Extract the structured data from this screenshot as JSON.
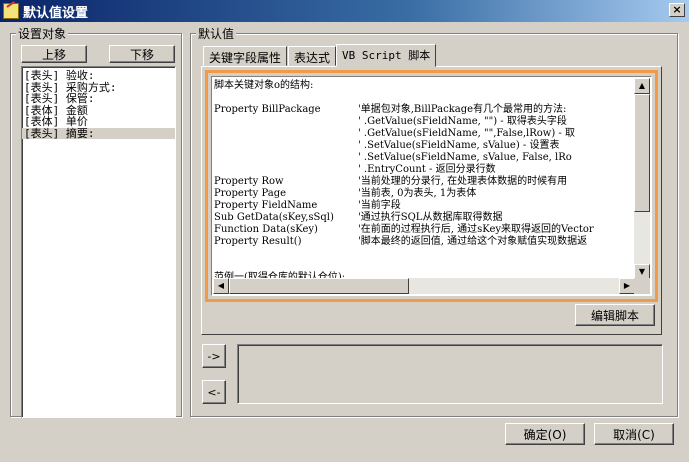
{
  "window": {
    "title": "默认值设置",
    "close_label": "×"
  },
  "left_panel": {
    "group_label": "设置对象",
    "move_up_label": "上移",
    "move_down_label": "下移",
    "items": [
      "[表头] 验收:",
      "[表头] 采购方式:",
      "[表头] 保管:",
      "[表体] 金额",
      "[表体] 单价",
      "[表头] 摘要:"
    ],
    "selected_index": 5
  },
  "right_panel": {
    "group_label": "默认值",
    "tabs": [
      "关键字段属性",
      "表达式",
      "VB Script 脚本"
    ],
    "active_tab": 2,
    "script_lines": [
      [
        "脚本关键对象o的结构:",
        ""
      ],
      [
        "",
        ""
      ],
      [
        "Property BillPackage",
        "'单据包对象,BillPackage有几个最常用的方法:"
      ],
      [
        "",
        "'         .GetValue(sFieldName, \"\") - 取得表头字段"
      ],
      [
        "",
        "'         .GetValue(sFieldName, \"\",False,lRow) - 取"
      ],
      [
        "",
        "'         .SetValue(sFieldName, sValue)  - 设置表"
      ],
      [
        "",
        "'         .SetValue(sFieldName, sValue, False, lRo"
      ],
      [
        "",
        "'         .EntryCount - 返回分录行数"
      ],
      [
        "Property Row",
        "'当前处理的分录行, 在处理表体数据的时候有用"
      ],
      [
        "Property Page",
        "'当前表, 0为表头, 1为表体"
      ],
      [
        "Property FieldName",
        "'当前字段"
      ],
      [
        "Sub GetData(sKey,sSql)",
        "'通过执行SQL从数据库取得数据"
      ],
      [
        "Function Data(sKey)",
        "'在前面的过程执行后, 通过sKey来取得返回的Vector"
      ],
      [
        "Property Result()",
        "'脚本最终的返回值, 通过给这个对象赋值实现数据返"
      ],
      [
        "",
        ""
      ],
      [
        "",
        ""
      ],
      [
        "范例一(取得仓库的默认仓位):",
        ""
      ]
    ],
    "edit_script_label": "编辑脚本",
    "add_label": "->",
    "remove_label": "<-"
  },
  "footer": {
    "ok_label": "确定(O)",
    "cancel_label": "取消(C)"
  },
  "colors": {
    "titlebar": "#0a246a",
    "accent_frame": "#f29b46",
    "face": "#d4d0c8"
  }
}
